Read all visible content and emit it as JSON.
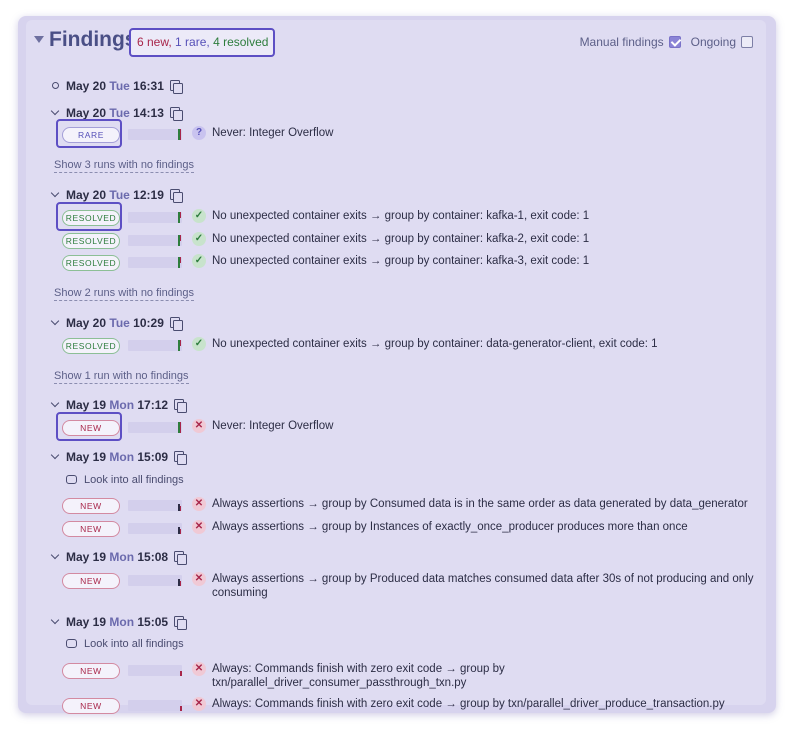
{
  "header": {
    "title": "Findings",
    "summary": {
      "new": "6 new,",
      "rare": "1 rare,",
      "resolved": "4 resolved"
    },
    "manual_label": "Manual findings",
    "manual_checked": true,
    "ongoing_label": "Ongoing",
    "ongoing_checked": false
  },
  "runs": [
    {
      "date": "May 20",
      "dow": "Tue",
      "time": "16:31"
    },
    {
      "date": "May 20",
      "dow": "Tue",
      "time": "14:13"
    },
    {
      "date": "May 20",
      "dow": "Tue",
      "time": "12:19"
    },
    {
      "date": "May 20",
      "dow": "Tue",
      "time": "10:29"
    },
    {
      "date": "May 19",
      "dow": "Mon",
      "time": "17:12"
    },
    {
      "date": "May 19",
      "dow": "Mon",
      "time": "15:09"
    },
    {
      "date": "May 19",
      "dow": "Mon",
      "time": "15:08"
    },
    {
      "date": "May 19",
      "dow": "Mon",
      "time": "15:05"
    }
  ],
  "show_links": [
    "Show 3 runs with no findings",
    "Show 2 runs with no findings",
    "Show 1 run with no findings"
  ],
  "look_label": "Look into all findings",
  "findings": [
    {
      "badge": "RARE",
      "text": "Never: Integer Overflow"
    },
    {
      "badge": "RESOLVED",
      "text": "No unexpected container exits → group by container: kafka-1, exit code: 1"
    },
    {
      "badge": "RESOLVED",
      "text": "No unexpected container exits → group by container: kafka-2, exit code: 1"
    },
    {
      "badge": "RESOLVED",
      "text": "No unexpected container exits → group by container: kafka-3, exit code: 1"
    },
    {
      "badge": "RESOLVED",
      "text": "No unexpected container exits → group by container: data-generator-client, exit code: 1"
    },
    {
      "badge": "NEW",
      "text": "Never: Integer Overflow"
    },
    {
      "badge": "NEW",
      "text": "Always assertions → group by Consumed data is in the same order as data generated by data_generator"
    },
    {
      "badge": "NEW",
      "text": "Always assertions → group by Instances of exactly_once_producer produces more than once"
    },
    {
      "badge": "NEW",
      "text": "Always assertions → group by Produced data matches consumed data after 30s of not producing and only consuming"
    },
    {
      "badge": "NEW",
      "text": "Always: Commands finish with zero exit code → group by txn/parallel_driver_consumer_passthrough_txn.py"
    },
    {
      "badge": "NEW",
      "text": "Always: Commands finish with zero exit code → group by txn/parallel_driver_produce_transaction.py"
    }
  ],
  "colors": {
    "accent": "#5d4fc4",
    "new": "#a8264a",
    "rare": "#5650b8",
    "resolved": "#2e7d3d"
  }
}
